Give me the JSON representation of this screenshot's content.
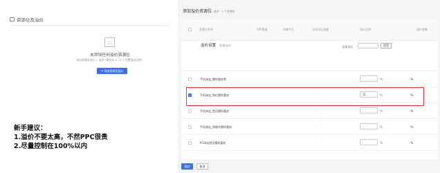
{
  "left": {
    "header_title": "资源位及溢价",
    "empty_icon_text": "□□",
    "empty_title": "未添加任何溢价资源位",
    "empty_desc": "溢价资源位出价 = 宝贝人群出价 X（1 + 位置溢价比例）",
    "add_button": "+ 添加资源位溢价"
  },
  "tip": {
    "line1": "新手建议：",
    "line2": "1.溢价不要太高，不然PPC很贵",
    "line3": "2.尽量控制在100%以内"
  },
  "right": {
    "title": "添加溢价资源位",
    "count_text": "选中：1 个资源位",
    "columns": [
      "资源位名称",
      "APP渠道",
      "所属平台",
      "日均可见流量",
      "溢价比例",
      "溢价效果"
    ],
    "set_label": "溢价设置",
    "set_sub": "（批量溢价）",
    "bulk_label": "批量溢价",
    "apply_button": "应用",
    "rows": [
      {
        "name": "手机淘宝_猜你喜欢等",
        "app": "-",
        "platform": "-",
        "traffic": "-",
        "value": "",
        "pct": "%",
        "result": "-%"
      },
      {
        "name": "手机淘宝_购后猜你喜欢",
        "app": "-",
        "platform": "-",
        "traffic": "-",
        "value": "11",
        "pct": "%",
        "result": "-%"
      },
      {
        "name": "手机淘宝_首页猜你喜欢",
        "app": "-",
        "platform": "-",
        "traffic": "-",
        "value": "",
        "pct": "%",
        "result": "-%"
      },
      {
        "name": "手机淘宝_购物车猜你喜欢",
        "app": "-",
        "platform": "-",
        "traffic": "-",
        "value": "",
        "pct": "%",
        "result": "-%"
      },
      {
        "name": "PC网站首页猜你喜欢",
        "app": "-",
        "platform": "-",
        "traffic": "-",
        "value": "",
        "pct": "%",
        "result": "-%"
      }
    ],
    "ok_button": "确定",
    "cancel_button": "取消"
  }
}
